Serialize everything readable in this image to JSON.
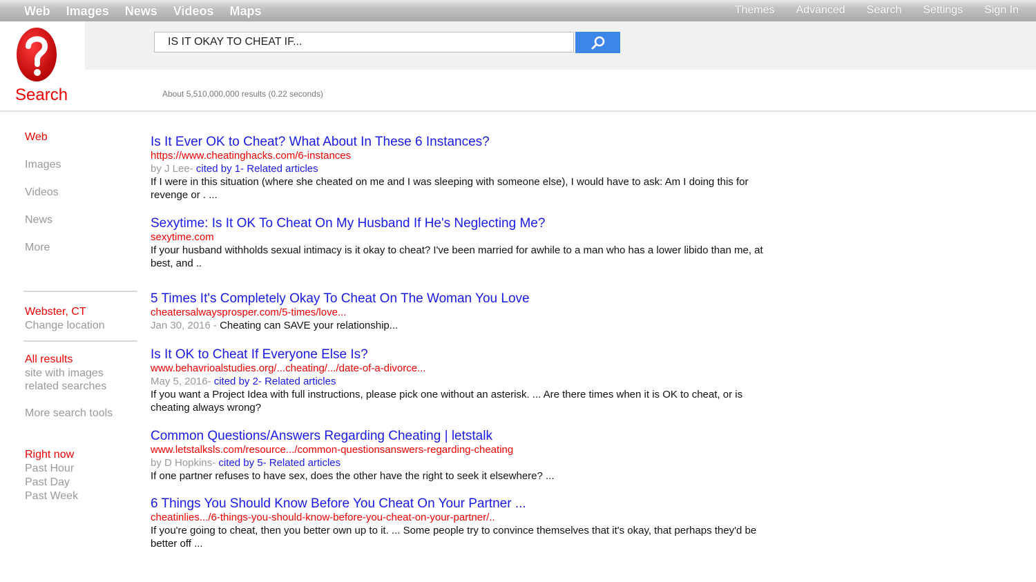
{
  "topnav": {
    "left": [
      "Web",
      "Images",
      "News",
      "Videos",
      "Maps"
    ],
    "right": [
      "Themes",
      "Advanced",
      "Search",
      "Settings",
      "Sign In"
    ]
  },
  "logo": {
    "text": "Search"
  },
  "search": {
    "query": "IS IT OKAY TO CHEAT IF..."
  },
  "results_count": "About 5,510,000,000 results (0.22 seconds)",
  "sidebar": {
    "nav": [
      "Web",
      "Images",
      "Videos",
      "News",
      "More"
    ],
    "location": {
      "city": "Webster, CT",
      "change": "Change location"
    },
    "filters": {
      "all": "All results",
      "images": "site with images",
      "related": "related searches",
      "more_tools": "More search tools"
    },
    "time": {
      "now": "Right now",
      "hour": "Past Hour",
      "day": "Past Day",
      "week": "Past Week"
    }
  },
  "results": [
    {
      "title": "Is It Ever OK to Cheat? What About In These 6 Instances?",
      "url": "https://www.cheatinghacks.com/6-instances",
      "meta_gray": "by J Lee- ",
      "meta_blue": "cited by 1- Related articles",
      "snippet": "If I were in this situation (where she cheated on me and I was sleeping with someone else), I would have to ask: Am I doing this for revenge or . ..."
    },
    {
      "title": "Sexytime: Is It OK To Cheat On My Husband If He's Neglecting Me?",
      "url": "sexytime.com",
      "snippet": "If your husband withholds sexual intimacy is it okay to cheat? I've been married for awhile to a man who has a lower libido than me, at best, and .."
    },
    {
      "title": "5 Times It's Completely Okay To Cheat On The Woman You Love",
      "url": "cheatersalwaysprosper.com/5-times/love...",
      "meta_gray": "Jan 30, 2016 - ",
      "meta_dark": "Cheating can SAVE your relationship..."
    },
    {
      "title": "Is It OK to Cheat If Everyone Else Is?",
      "url": "www.behavrioalstudies.org/...cheating/.../date-of-a-divorce...",
      "meta_gray": "May 5, 2016- ",
      "meta_blue": "cited by 2- Related articles",
      "snippet": "If you want a Project Idea with full instructions, please pick one without an asterisk. ... Are there times when it is OK to cheat, or is cheating always wrong?"
    },
    {
      "title": "Common Questions/Answers Regarding Cheating | letstalk",
      "url": "www.letstalksls.com/resource.../common-questionsanswers-regarding-cheating",
      "meta_gray": "by D Hopkins- ",
      "meta_blue": "cited by 5- Related articles",
      "snippet": "If one partner refuses to have sex, does the other have the right to seek it elsewhere? ..."
    },
    {
      "title": "6 Things You Should Know Before You Cheat On Your Partner ...",
      "url": "cheatinlies.../6-things-you-should-know-before-you-cheat-on-your-partner/..",
      "snippet": "If you're going to cheat, then you better own up to it. ... Some people try to convince themselves that it's okay, that perhaps they'd be better off ..."
    }
  ],
  "colors": {
    "accent_red": "#ee0000",
    "link_blue": "#1a1ae6",
    "search_button": "#3d86e8"
  }
}
